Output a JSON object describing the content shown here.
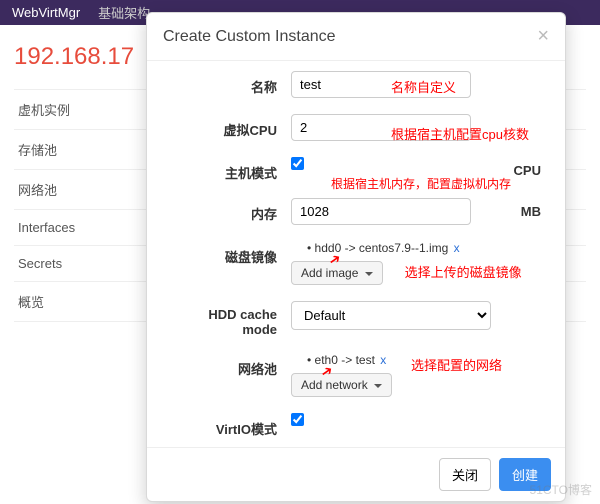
{
  "topbar": {
    "brand": "WebVirtMgr",
    "nav1": "基础架构"
  },
  "ip": "192.168.17",
  "sidebar": {
    "items": [
      "虚机实例",
      "存储池",
      "网络池",
      "Interfaces",
      "Secrets",
      "概览"
    ]
  },
  "modal": {
    "title": "Create Custom Instance",
    "labels": {
      "name": "名称",
      "vcpu": "虚拟CPU",
      "host_mode": "主机模式",
      "memory": "内存",
      "disk_image": "磁盘镜像",
      "hdd_cache": "HDD cache mode",
      "net_pool": "网络池",
      "virtio": "VirtIO模式"
    },
    "values": {
      "name": "test",
      "vcpu": "2",
      "memory": "1028",
      "disk_item": "hdd0 -> centos7.9--1.img",
      "net_item": "eth0 -> test",
      "cache_mode": "Default"
    },
    "suffix": {
      "cpu": "CPU",
      "mb": "MB"
    },
    "buttons": {
      "add_image": "Add image",
      "add_network": "Add network",
      "close": "关闭",
      "create": "创建"
    },
    "remove": "x",
    "notes": {
      "name": "名称自定义",
      "vcpu": "根据宿主机配置cpu核数",
      "memory": "根据宿主机内存，配置虚拟机内存",
      "disk": "选择上传的磁盘镜像",
      "net": "选择配置的网络"
    }
  },
  "watermark": "51CTO博客"
}
